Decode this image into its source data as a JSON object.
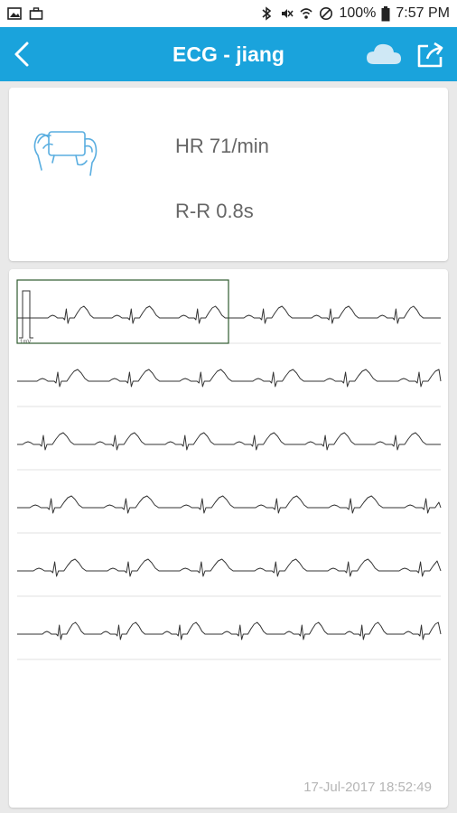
{
  "statusbar": {
    "battery": "100%",
    "time": "7:57 PM",
    "icons": [
      "gallery-icon",
      "briefcase-icon",
      "bluetooth-icon",
      "mute-icon",
      "wifi-icon",
      "do-not-disturb-icon",
      "battery-icon"
    ]
  },
  "appbar": {
    "title": "ECG - jiang",
    "left_icon": "back-arrow-icon",
    "right_icons": [
      "cloud-icon",
      "share-icon"
    ]
  },
  "info": {
    "illustration": "hands-holding-device-icon",
    "hr": "HR 71/min",
    "rr": "R-R 0.8s"
  },
  "ecg": {
    "rows": 6,
    "calibration_label": "1mV",
    "timestamp": "17-Jul-2017 18:52:49",
    "grid_color": "#e2e2e2",
    "trace_color": "#333333",
    "highlight_color": "#2f5b2f"
  },
  "colors": {
    "appbar": "#1aa3dc",
    "background": "#e9e9e9"
  }
}
